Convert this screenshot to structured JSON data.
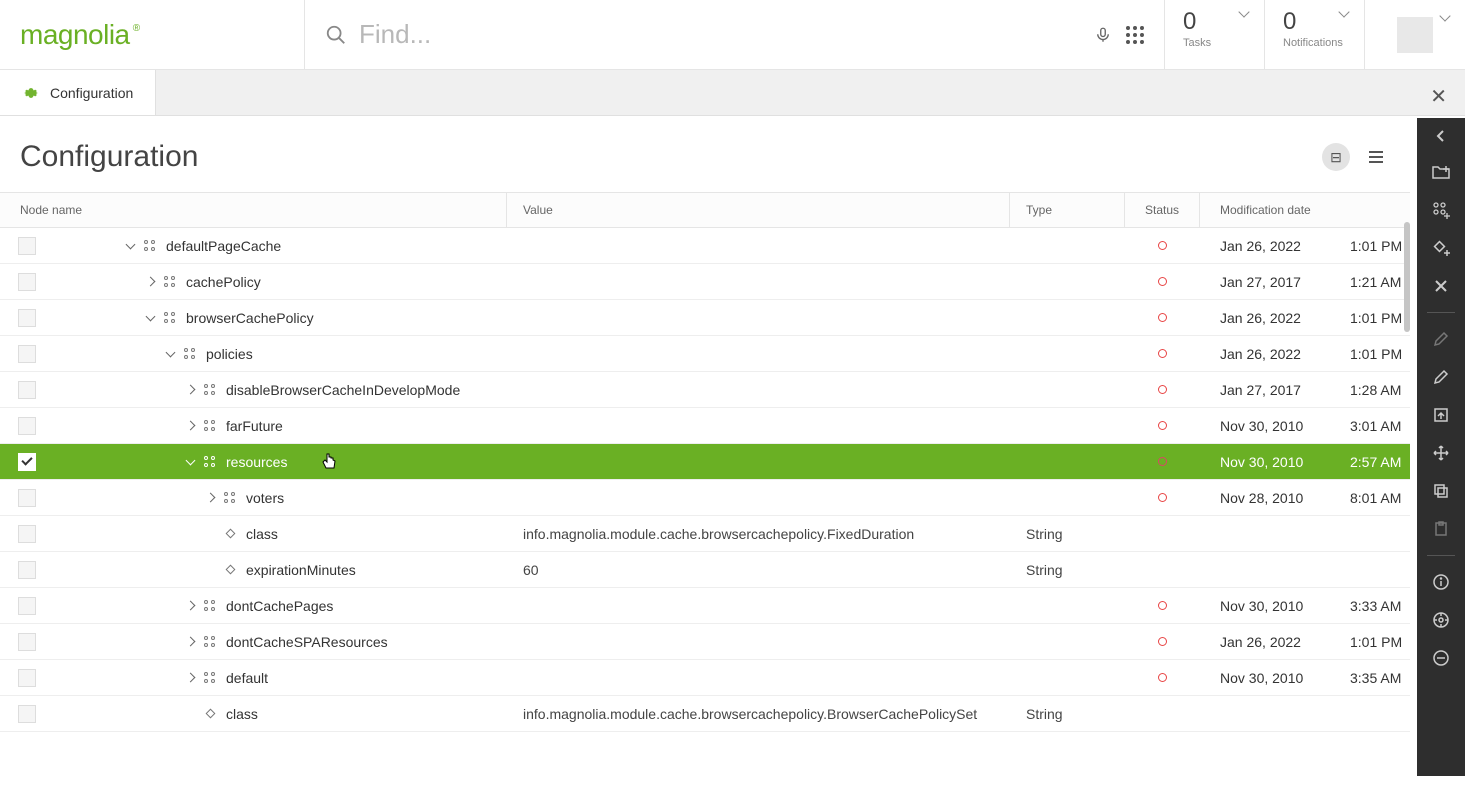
{
  "brand": "magnolia",
  "search": {
    "placeholder": "Find..."
  },
  "pills": {
    "tasks": {
      "count": "0",
      "label": "Tasks"
    },
    "notifications": {
      "count": "0",
      "label": "Notifications"
    }
  },
  "tab": {
    "label": "Configuration"
  },
  "page": {
    "title": "Configuration"
  },
  "columns": {
    "node": "Node name",
    "value": "Value",
    "type": "Type",
    "status": "Status",
    "mod": "Modification date"
  },
  "rows": [
    {
      "indent": 80,
      "expand": "down",
      "icon": "content",
      "name": "defaultPageCache",
      "value": "",
      "type": "",
      "status": true,
      "date": "Jan 26, 2022",
      "time": "1:01 PM",
      "selected": false
    },
    {
      "indent": 100,
      "expand": "right",
      "icon": "content",
      "name": "cachePolicy",
      "value": "",
      "type": "",
      "status": true,
      "date": "Jan 27, 2017",
      "time": "1:21 AM",
      "selected": false
    },
    {
      "indent": 100,
      "expand": "down",
      "icon": "content",
      "name": "browserCachePolicy",
      "value": "",
      "type": "",
      "status": true,
      "date": "Jan 26, 2022",
      "time": "1:01 PM",
      "selected": false
    },
    {
      "indent": 120,
      "expand": "down",
      "icon": "content",
      "name": "policies",
      "value": "",
      "type": "",
      "status": true,
      "date": "Jan 26, 2022",
      "time": "1:01 PM",
      "selected": false
    },
    {
      "indent": 140,
      "expand": "right",
      "icon": "content",
      "name": "disableBrowserCacheInDevelopMode",
      "value": "",
      "type": "",
      "status": true,
      "date": "Jan 27, 2017",
      "time": "1:28 AM",
      "selected": false
    },
    {
      "indent": 140,
      "expand": "right",
      "icon": "content",
      "name": "farFuture",
      "value": "",
      "type": "",
      "status": true,
      "date": "Nov 30, 2010",
      "time": "3:01 AM",
      "selected": false
    },
    {
      "indent": 140,
      "expand": "down",
      "icon": "content",
      "name": "resources",
      "value": "",
      "type": "",
      "status": true,
      "date": "Nov 30, 2010",
      "time": "2:57 AM",
      "selected": true
    },
    {
      "indent": 160,
      "expand": "right",
      "icon": "content",
      "name": "voters",
      "value": "",
      "type": "",
      "status": true,
      "date": "Nov 28, 2010",
      "time": "8:01 AM",
      "selected": false
    },
    {
      "indent": 160,
      "expand": "none",
      "icon": "prop",
      "name": "class",
      "value": "info.magnolia.module.cache.browsercachepolicy.FixedDuration",
      "type": "String",
      "status": false,
      "date": "",
      "time": "",
      "selected": false
    },
    {
      "indent": 160,
      "expand": "none",
      "icon": "prop",
      "name": "expirationMinutes",
      "value": "60",
      "type": "String",
      "status": false,
      "date": "",
      "time": "",
      "selected": false
    },
    {
      "indent": 140,
      "expand": "right",
      "icon": "content",
      "name": "dontCachePages",
      "value": "",
      "type": "",
      "status": true,
      "date": "Nov 30, 2010",
      "time": "3:33 AM",
      "selected": false
    },
    {
      "indent": 140,
      "expand": "right",
      "icon": "content",
      "name": "dontCacheSPAResources",
      "value": "",
      "type": "",
      "status": true,
      "date": "Jan 26, 2022",
      "time": "1:01 PM",
      "selected": false
    },
    {
      "indent": 140,
      "expand": "right",
      "icon": "content",
      "name": "default",
      "value": "",
      "type": "",
      "status": true,
      "date": "Nov 30, 2010",
      "time": "3:35 AM",
      "selected": false
    },
    {
      "indent": 140,
      "expand": "none",
      "icon": "prop",
      "name": "class",
      "value": "info.magnolia.module.cache.browsercachepolicy.BrowserCachePolicySet",
      "type": "String",
      "status": false,
      "date": "",
      "time": "",
      "selected": false
    }
  ],
  "rail": [
    {
      "id": "add-folder",
      "glyph": "folder-plus"
    },
    {
      "id": "add-content",
      "glyph": "dots-plus"
    },
    {
      "id": "add-property",
      "glyph": "diamond-plus"
    },
    {
      "id": "delete",
      "glyph": "x"
    },
    {
      "divider": true
    },
    {
      "id": "edit-grey",
      "glyph": "pencil-grey"
    },
    {
      "id": "edit",
      "glyph": "pencil"
    },
    {
      "id": "publish",
      "glyph": "publish"
    },
    {
      "id": "move",
      "glyph": "move"
    },
    {
      "id": "copy",
      "glyph": "copy"
    },
    {
      "id": "paste",
      "glyph": "paste"
    },
    {
      "divider": true
    },
    {
      "id": "info",
      "glyph": "info"
    },
    {
      "id": "tools",
      "glyph": "tools"
    },
    {
      "id": "collapse-all",
      "glyph": "collapse"
    }
  ]
}
